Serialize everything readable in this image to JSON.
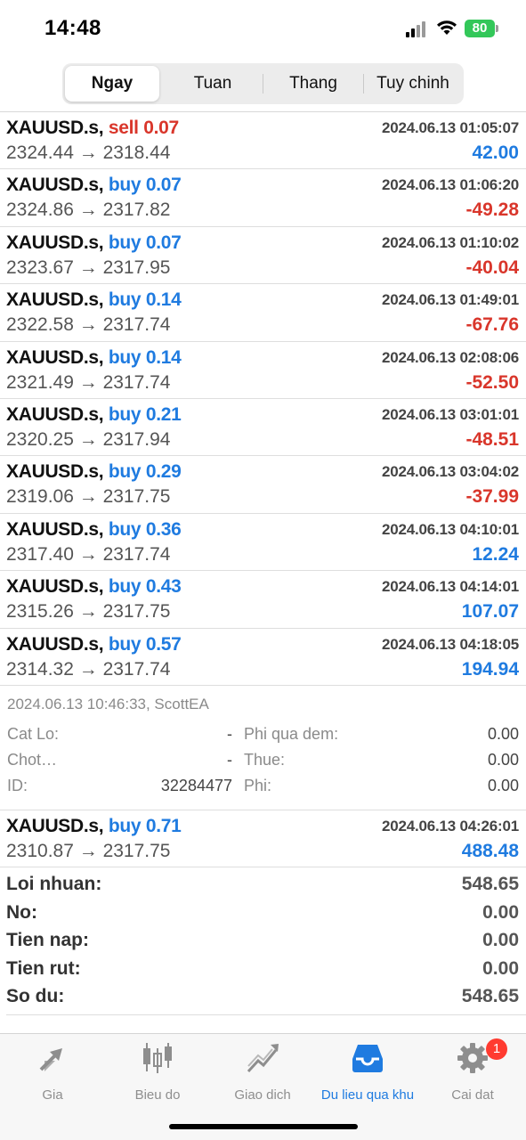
{
  "status_bar": {
    "time": "14:48",
    "battery": "80"
  },
  "segments": [
    {
      "label": "Ngay",
      "active": true
    },
    {
      "label": "Tuan",
      "active": false
    },
    {
      "label": "Thang",
      "active": false
    },
    {
      "label": "Tuy chinh",
      "active": false
    }
  ],
  "deals": [
    {
      "symbol": "XAUUSD.s,",
      "side": "sell 0.07",
      "date": "2024.06.13 01:05:07",
      "prices": "2324.44 → 2318.44",
      "profit": "42.00"
    },
    {
      "symbol": "XAUUSD.s,",
      "side": "buy 0.07",
      "date": "2024.06.13 01:06:20",
      "prices": "2324.86 → 2317.82",
      "profit": "-49.28"
    },
    {
      "symbol": "XAUUSD.s,",
      "side": "buy 0.07",
      "date": "2024.06.13 01:10:02",
      "prices": "2323.67 → 2317.95",
      "profit": "-40.04"
    },
    {
      "symbol": "XAUUSD.s,",
      "side": "buy 0.14",
      "date": "2024.06.13 01:49:01",
      "prices": "2322.58 → 2317.74",
      "profit": "-67.76"
    },
    {
      "symbol": "XAUUSD.s,",
      "side": "buy 0.14",
      "date": "2024.06.13 02:08:06",
      "prices": "2321.49 → 2317.74",
      "profit": "-52.50"
    },
    {
      "symbol": "XAUUSD.s,",
      "side": "buy 0.21",
      "date": "2024.06.13 03:01:01",
      "prices": "2320.25 → 2317.94",
      "profit": "-48.51"
    },
    {
      "symbol": "XAUUSD.s,",
      "side": "buy 0.29",
      "date": "2024.06.13 03:04:02",
      "prices": "2319.06 → 2317.75",
      "profit": "-37.99"
    },
    {
      "symbol": "XAUUSD.s,",
      "side": "buy 0.36",
      "date": "2024.06.13 04:10:01",
      "prices": "2317.40 → 2317.74",
      "profit": "12.24"
    },
    {
      "symbol": "XAUUSD.s,",
      "side": "buy 0.43",
      "date": "2024.06.13 04:14:01",
      "prices": "2315.26 → 2317.75",
      "profit": "107.07"
    },
    {
      "symbol": "XAUUSD.s,",
      "side": "buy 0.57",
      "date": "2024.06.13 04:18:05",
      "prices": "2314.32 → 2317.74",
      "profit": "194.94"
    }
  ],
  "detail": {
    "meta": "2024.06.13 10:46:33, ScottEA",
    "stop_loss_label": "Cat Lo:",
    "stop_loss_value": "-",
    "swap_label": "Phi qua dem:",
    "swap_value": "0.00",
    "take_profit_label": "Chot…",
    "take_profit_value": "-",
    "tax_label": "Thue:",
    "tax_value": "0.00",
    "id_label": "ID:",
    "id_value": "32284477",
    "fee_label": "Phi:",
    "fee_value": "0.00"
  },
  "last_deal": {
    "symbol": "XAUUSD.s,",
    "side": "buy 0.71",
    "date": "2024.06.13 04:26:01",
    "prices": "2310.87 → 2317.75",
    "profit": "488.48"
  },
  "summary": [
    {
      "label": "Loi nhuan:",
      "value": "548.65"
    },
    {
      "label": "No:",
      "value": "0.00"
    },
    {
      "label": "Tien nap:",
      "value": "0.00"
    },
    {
      "label": "Tien rut:",
      "value": "0.00"
    },
    {
      "label": "So du:",
      "value": "548.65"
    }
  ],
  "tabs": [
    {
      "label": "Gia",
      "icon": "price-arrows-icon",
      "active": false
    },
    {
      "label": "Bieu do",
      "icon": "candlestick-chart-icon",
      "active": false
    },
    {
      "label": "Giao dich",
      "icon": "trade-line-icon",
      "active": false
    },
    {
      "label": "Du lieu qua khu",
      "icon": "history-inbox-icon",
      "active": true
    },
    {
      "label": "Cai dat",
      "icon": "gear-icon",
      "active": false,
      "badge": "1"
    }
  ],
  "colors": {
    "buy": "#1f7be0",
    "sell": "#d9362b",
    "active_tab": "#1f7be0",
    "inactive_tab": "#8e8e8e"
  }
}
